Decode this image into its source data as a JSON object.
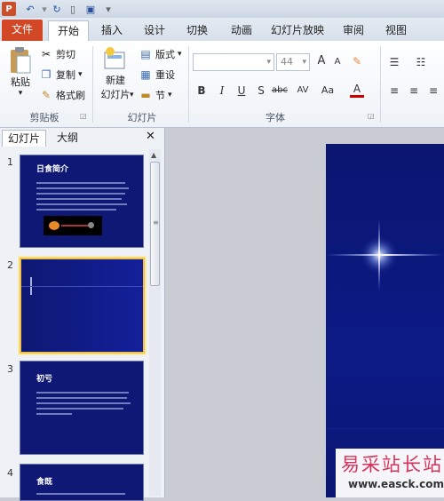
{
  "app": {
    "logo": "P"
  },
  "tabs": [
    "文件",
    "开始",
    "插入",
    "设计",
    "切换",
    "动画",
    "幻灯片放映",
    "审阅",
    "视图"
  ],
  "ribbon": {
    "clipboard": {
      "paste": "粘贴",
      "cut": "剪切",
      "copy": "复制",
      "format_painter": "格式刷",
      "label": "剪贴板"
    },
    "slides": {
      "new_slide_line1": "新建",
      "new_slide_line2": "幻灯片",
      "layout": "版式",
      "reset": "重设",
      "section": "节",
      "label": "幻灯片"
    },
    "font": {
      "size": "44",
      "bold": "B",
      "italic": "I",
      "underline": "U",
      "shadow": "S",
      "strike": "abc",
      "spacing": "AV",
      "case": "Aa",
      "color": "A",
      "grow": "A",
      "shrink": "A",
      "label": "字体"
    }
  },
  "panel": {
    "tabs": [
      "幻灯片",
      "大纲"
    ],
    "close": "✕",
    "thumbs": [
      {
        "num": "1",
        "title": "日食简介",
        "selected": false
      },
      {
        "num": "2",
        "title": "",
        "selected": true
      },
      {
        "num": "3",
        "title": "初亏",
        "selected": false
      },
      {
        "num": "4",
        "title": "食既",
        "selected": false
      }
    ]
  },
  "watermark": {
    "main": "易采站长站",
    "sub": "www.easck.com"
  }
}
